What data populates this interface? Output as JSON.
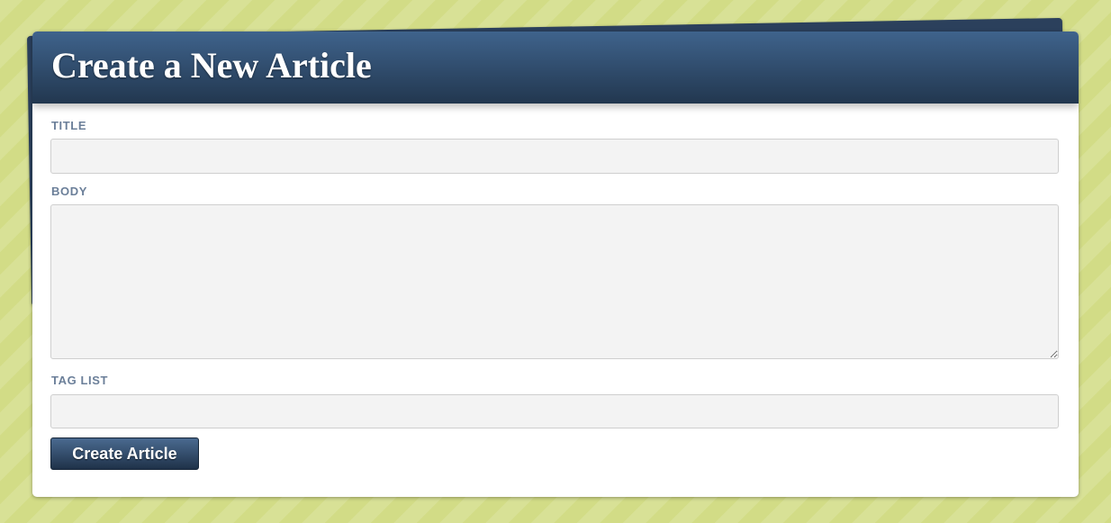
{
  "page": {
    "heading": "Create a New Article"
  },
  "form": {
    "title": {
      "label": "TITLE",
      "value": ""
    },
    "body": {
      "label": "BODY",
      "value": ""
    },
    "tag_list": {
      "label": "TAG LIST",
      "value": ""
    },
    "submit_label": "Create Article"
  },
  "colors": {
    "header_top": "#3f638c",
    "header_bottom": "#22374f",
    "label": "#6b7f99",
    "background": "#d4de8b"
  }
}
